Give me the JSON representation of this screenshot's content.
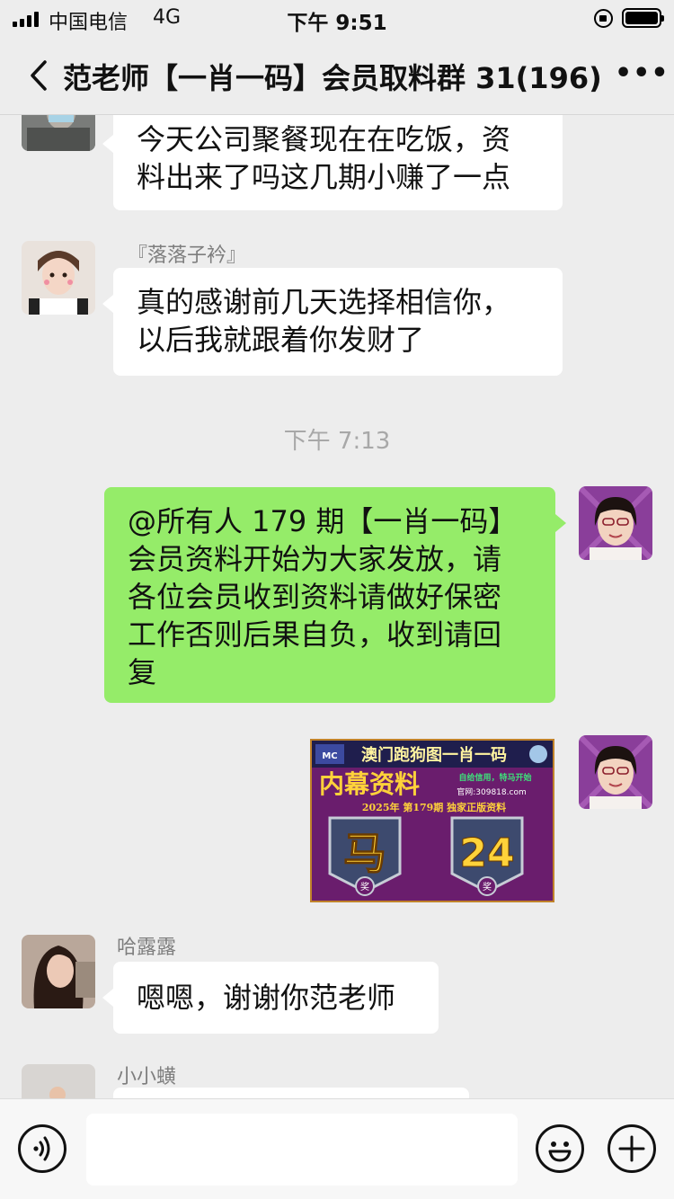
{
  "status_bar": {
    "carrier": "中国电信",
    "network": "4G",
    "time": "下午 9:51"
  },
  "nav": {
    "title": "范老师【一肖一码】会员取料群 31(196)",
    "back_icon": "chevron-left-icon",
    "more_icon": "more-dots-icon"
  },
  "messages": [
    {
      "type": "in",
      "sender": "",
      "lines": [
        "今天公司聚餐现在在吃饭，资",
        "料出来了吗这几期小赚了一点"
      ]
    },
    {
      "type": "in",
      "sender": "『落落子衿』",
      "lines": [
        "真的感谢前几天选择相信你，",
        "以后我就跟着你发财了"
      ]
    },
    {
      "type": "time",
      "text": "下午 7:13"
    },
    {
      "type": "out",
      "lines": [
        "@所有人 179 期【一肖一码】",
        "会员资料开始为大家发放，请",
        "各位会员收到资料请做好保密",
        "工作否则后果自负，收到请回",
        "复"
      ]
    },
    {
      "type": "out-image",
      "image": {
        "headline": "澳门跑狗图一肖一码",
        "subtitle": "内幕资料",
        "slogan": "自给信用，特马开始",
        "site": "官网:309818.com",
        "issue": "2025年 第179期 独家正版资料",
        "zodiac": "马",
        "number": "24",
        "badge": "奖"
      }
    },
    {
      "type": "in",
      "sender": "哈露露",
      "lines": [
        "嗯嗯，谢谢你范老师"
      ]
    },
    {
      "type": "in",
      "sender": "小小蟥",
      "lines": []
    }
  ],
  "input_bar": {
    "voice_icon": "voice-icon",
    "placeholder": "",
    "emoji_icon": "emoji-icon",
    "plus_icon": "plus-icon"
  },
  "colors": {
    "background": "#ededed",
    "incoming_bubble": "#ffffff",
    "outgoing_bubble": "#95ec69",
    "sender_name": "#7e7e7e",
    "promo_bg": "#6a1d6d",
    "promo_gold": "#ffd23a"
  }
}
